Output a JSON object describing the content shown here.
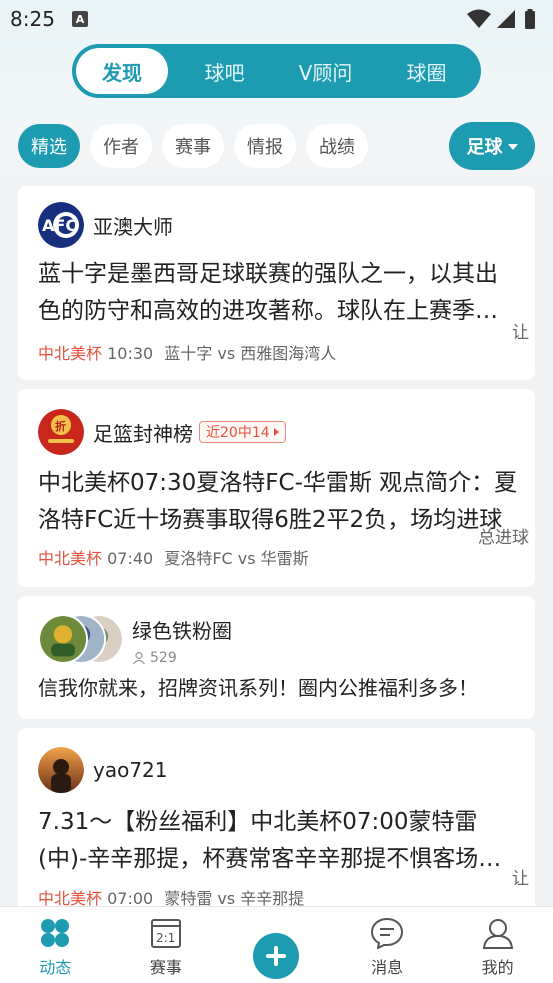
{
  "status_bar": {
    "time": "8:25",
    "notification_icon": "A"
  },
  "top_tabs": [
    {
      "label": "发现",
      "active": true
    },
    {
      "label": "球吧",
      "active": false
    },
    {
      "label": "V顾问",
      "active": false
    },
    {
      "label": "球圈",
      "active": false
    }
  ],
  "filter_chips": [
    {
      "label": "精选",
      "active": true
    },
    {
      "label": "作者",
      "active": false
    },
    {
      "label": "赛事",
      "active": false
    },
    {
      "label": "情报",
      "active": false
    },
    {
      "label": "战绩",
      "active": false
    }
  ],
  "sport_selector": {
    "label": "足球"
  },
  "feed": {
    "post1": {
      "author": "亚澳大师",
      "avatar_text": "AFC",
      "title": "蓝十字是墨西哥足球联赛的强队之一，以其出色的防守和高效的进攻著称。球队在上赛季的表现非常稳定",
      "league": "中北美杯",
      "time": "10:30",
      "match": "蓝十字 vs 西雅图海湾人",
      "side_tag": "让"
    },
    "post2": {
      "author": "足篮封神榜",
      "avatar_text": "折",
      "badge": "近20中14",
      "title": "中北美杯07:30夏洛特FC-华雷斯 观点简介：夏洛特FC近十场赛事取得6胜2平2负，场均进球",
      "league": "中北美杯",
      "time": "07:40",
      "match": "夏洛特FC vs 华雷斯",
      "side_tag": "总进球"
    },
    "circle": {
      "name": "绿色铁粉圈",
      "member_count": "529",
      "description": "信我你就来，招牌资讯系列！圈内公推福利多多！"
    },
    "post3": {
      "author": "yao721",
      "title": "7.31～【粉丝福利】中北美杯07:00蒙特雷(中)-辛辛那提，杯赛常客辛辛那提不惧客场作战",
      "league": "中北美杯",
      "time": "07:00",
      "match": "蒙特雷 vs 辛辛那提",
      "side_tag": "让"
    }
  },
  "bottom_nav": [
    {
      "label": "动态",
      "icon": "clover-icon",
      "active": true
    },
    {
      "label": "赛事",
      "icon": "scoreboard-icon",
      "active": false,
      "icon_text": "2:1"
    },
    {
      "label": "",
      "icon": "plus-icon",
      "active": false
    },
    {
      "label": "消息",
      "icon": "chat-icon",
      "active": false
    },
    {
      "label": "我的",
      "icon": "user-icon",
      "active": false
    }
  ],
  "colors": {
    "accent": "#1d9bb0",
    "league_red": "#e5533f",
    "background": "#f2f3f5"
  }
}
